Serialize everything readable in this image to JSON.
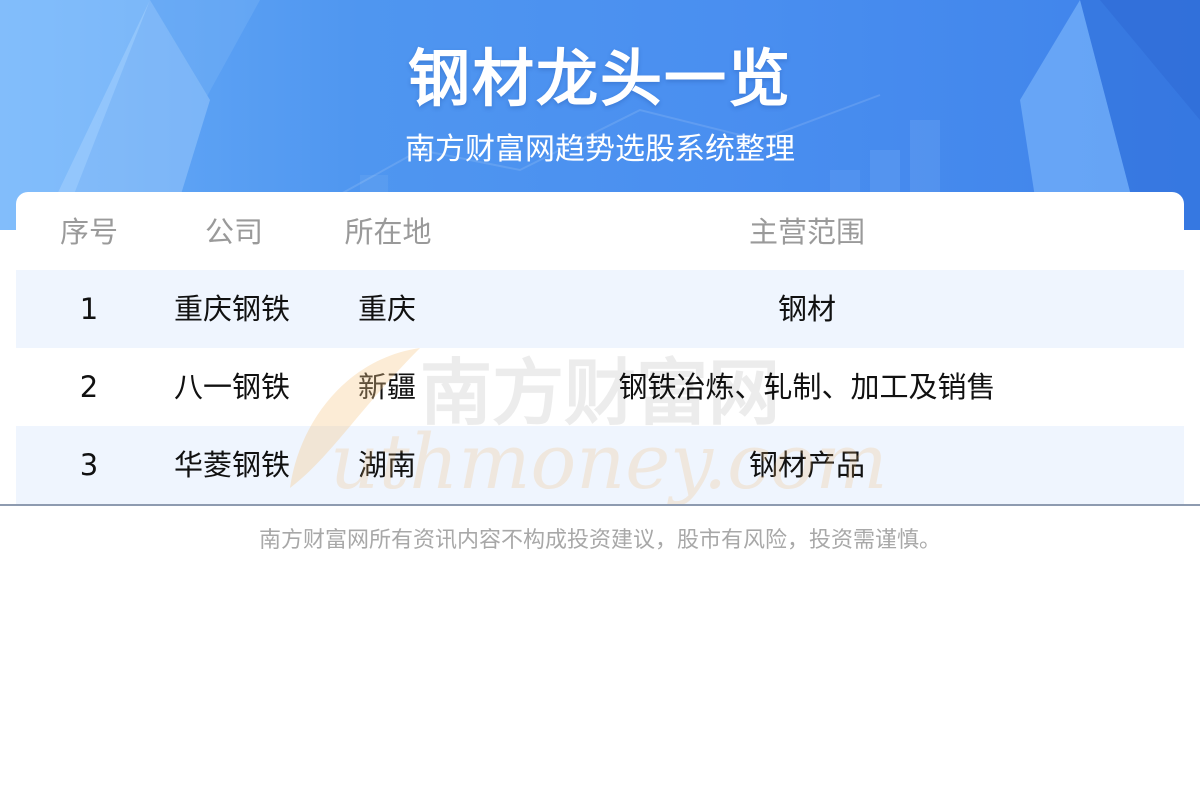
{
  "header": {
    "title": "钢材龙头一览",
    "subtitle": "南方财富网趋势选股系统整理"
  },
  "table": {
    "columns": [
      "序号",
      "公司",
      "所在地",
      "主营范围"
    ],
    "rows": [
      {
        "index": "1",
        "company": "重庆钢铁",
        "location": "重庆",
        "business": "钢材"
      },
      {
        "index": "2",
        "company": "八一钢铁",
        "location": "新疆",
        "business": "钢铁冶炼、轧制、加工及销售"
      },
      {
        "index": "3",
        "company": "华菱钢铁",
        "location": "湖南",
        "business": "钢材产品"
      }
    ]
  },
  "watermark": {
    "text_cn": "南方财富网",
    "text_en": "uthmoney.com"
  },
  "footer": {
    "disclaimer": "南方财富网所有资讯内容不构成投资建议，股市有风险，投资需谨慎。"
  },
  "colors": {
    "banner_start": "#6aaef8",
    "banner_end": "#3f83ea",
    "stripe": "#eff5fe",
    "header_text": "#9a9a9a",
    "body_text": "#111111",
    "disclaimer_text": "#a8a8a8"
  }
}
